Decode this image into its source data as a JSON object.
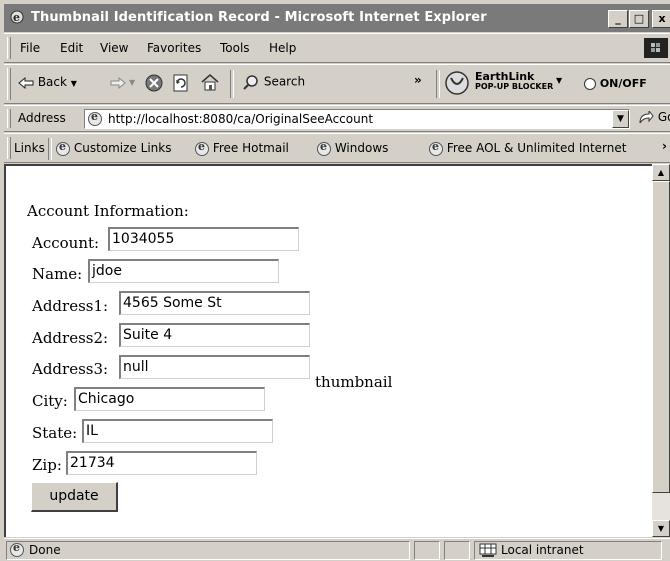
{
  "window": {
    "title": "Thumbnail Identification Record - Microsoft Internet Explorer",
    "minimize": "_",
    "maximize": "□",
    "close": "x"
  },
  "menu": [
    "File",
    "Edit",
    "View",
    "Favorites",
    "Tools",
    "Help"
  ],
  "toolbar": {
    "back": "Back",
    "search": "Search",
    "chevron": "»",
    "earthlink_top": "EarthLink",
    "earthlink_bottom": "POP-UP BLOCKER",
    "on_off": "ON/OFF"
  },
  "address": {
    "label": "Address",
    "url": "http://localhost:8080/ca/OriginalSeeAccount",
    "go": "Go"
  },
  "links": {
    "label": "Links",
    "items": [
      "Customize Links",
      "Free Hotmail",
      "Windows",
      "Free AOL & Unlimited Internet"
    ]
  },
  "form": {
    "heading": "Account Information:",
    "account_label": "Account:",
    "account_value": "1034055",
    "name_label": "Name:",
    "name_value": "jdoe",
    "address1_label": "Address1:",
    "address1_value": "4565 Some St",
    "address2_label": "Address2:",
    "address2_value": "Suite 4",
    "address3_label": "Address3:",
    "address3_value": "null",
    "thumbnail_text": "thumbnail",
    "city_label": "City:",
    "city_value": "Chicago",
    "state_label": "State:",
    "state_value": "IL",
    "zip_label": "Zip:",
    "zip_value": "21734",
    "update_label": "update"
  },
  "status": {
    "text": "Done",
    "zone": "Local intranet"
  }
}
